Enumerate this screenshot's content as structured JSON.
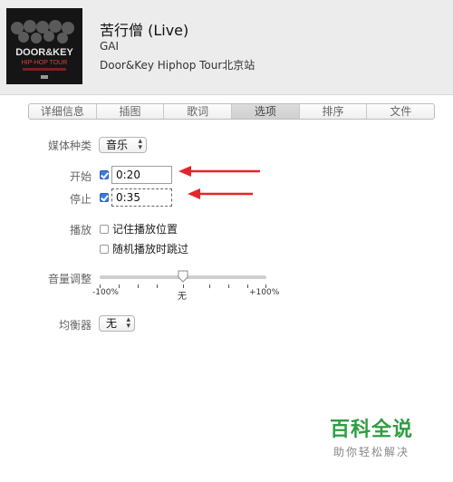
{
  "song": {
    "title": "苦行僧 (Live)",
    "artist": "GAI",
    "album": "Door&Key Hiphop Tour北京站"
  },
  "album_art": {
    "text_top": "DOOR&KEY",
    "text_mid": "HIP-HOP TOUR"
  },
  "tabs": [
    "详细信息",
    "插图",
    "歌词",
    "选项",
    "排序",
    "文件"
  ],
  "active_tab": "选项",
  "media_kind": {
    "label": "媒体种类",
    "value": "音乐"
  },
  "start": {
    "label": "开始",
    "checked": true,
    "value": "0:20"
  },
  "stop": {
    "label": "停止",
    "checked": true,
    "value": "0:35"
  },
  "playback": {
    "label": "播放",
    "remember_position": "记住播放位置",
    "skip_shuffle": "随机播放时跳过"
  },
  "volume": {
    "label": "音量调整",
    "min_label": "-100%",
    "mid_label": "无",
    "max_label": "+100%",
    "level_percent": 0
  },
  "equalizer": {
    "label": "均衡器",
    "value": "无"
  },
  "watermark": {
    "title": "百科全说",
    "subtitle": "助你轻松解决"
  },
  "colors": {
    "annotation_arrow": "#e3262b",
    "checkbox": "#3c7be0",
    "watermark": "#2f9e43"
  }
}
